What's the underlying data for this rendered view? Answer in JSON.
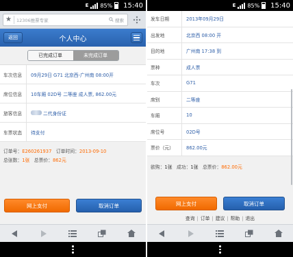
{
  "status_bar": {
    "network": "E",
    "battery": "85%",
    "time": "15:40"
  },
  "browser": {
    "url_placeholder": "12306推票专家",
    "search_label": "搜索"
  },
  "left": {
    "header": {
      "back_label": "返回",
      "title": "个人中心"
    },
    "tabs": [
      {
        "label": "已完成订单",
        "active": false
      },
      {
        "label": "未完成订单",
        "active": true
      }
    ],
    "rows": [
      {
        "label": "车次信息",
        "value": "09月29日 G71 北京西-广州南 08:00开"
      },
      {
        "label": "席位信息",
        "value": "10车厢 02D号 二等座 成人票, 862.00元"
      },
      {
        "label": "旅客信息",
        "value": "二代身份证"
      },
      {
        "label": "车票状态",
        "value": "待支付"
      }
    ],
    "summary": {
      "order_no_label": "订单号：",
      "order_no": "E260261937",
      "order_time_label": "订单时间：",
      "order_time": "2013-09-10",
      "total_count_label": "总张数：",
      "total_count": "1张",
      "total_price_label": "总票价：",
      "total_price": "862元"
    },
    "buttons": {
      "pay": "网上支付",
      "cancel": "取消订单"
    }
  },
  "right": {
    "rows": [
      {
        "label": "发车日期",
        "value": "2013年09月29日"
      },
      {
        "label": "出发地",
        "value": "北京西  08:00 开"
      },
      {
        "label": "目的地",
        "value": "广州南  17:38 到"
      },
      {
        "label": "票种",
        "value": "成人票"
      },
      {
        "label": "车次",
        "value": "G71"
      },
      {
        "label": "席别",
        "value": "二等座"
      },
      {
        "label": "车厢",
        "value": "10"
      },
      {
        "label": "席位号",
        "value": "02D号"
      },
      {
        "label": "票价（元）",
        "value": "862.00元"
      }
    ],
    "summary": {
      "request_label": "欲购：",
      "request": "1张",
      "success_label": "成功：",
      "success": "1张",
      "total_label": "总票价：",
      "total": "862.00元"
    },
    "buttons": {
      "pay": "网上支付",
      "cancel": "取消订单"
    },
    "footer_links": [
      "查询",
      "订单",
      "建议",
      "帮助",
      "退出"
    ]
  }
}
